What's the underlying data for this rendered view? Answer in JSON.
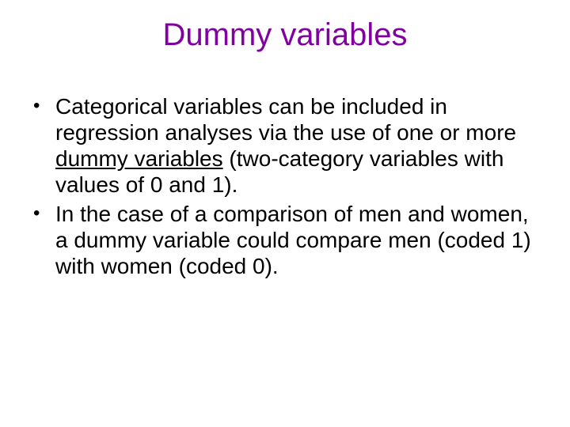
{
  "title": "Dummy variables",
  "bullets": [
    {
      "pre": "Categorical variables can be included in regression analyses via the use of one or more ",
      "underline": "dummy variables",
      "post": " (two-category variables with values of 0 and 1)."
    },
    {
      "pre": "In the case of a comparison of men and women, a dummy variable could compare men (coded 1) with women (coded 0).",
      "underline": "",
      "post": ""
    }
  ]
}
